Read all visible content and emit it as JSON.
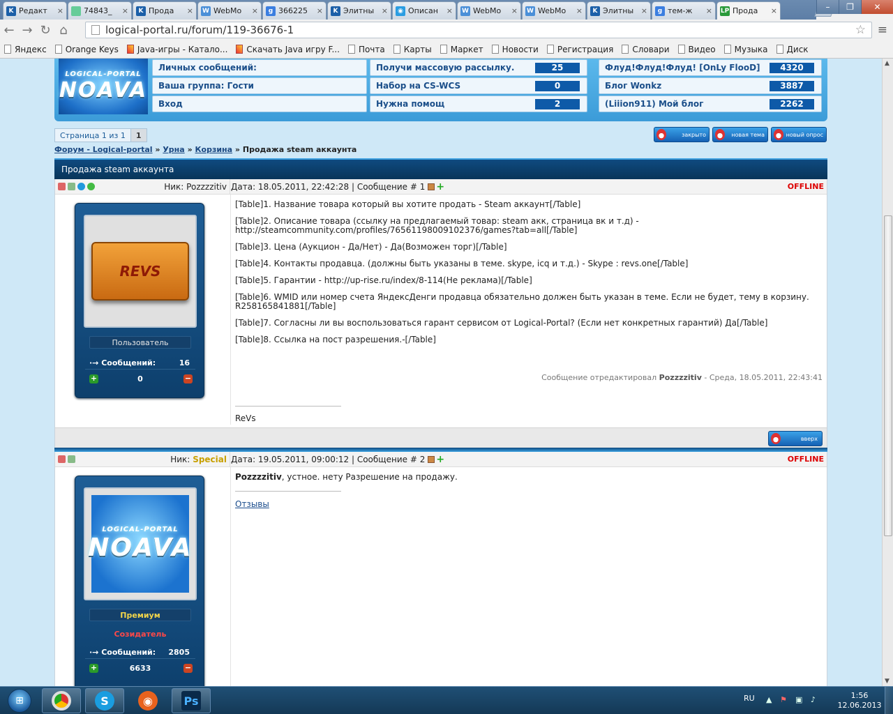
{
  "browser": {
    "tabs": [
      {
        "title": "Редакт",
        "icon_color": "#1b5fa8",
        "glyph": "K"
      },
      {
        "title": "74843_",
        "icon_color": "#6c9",
        "glyph": ""
      },
      {
        "title": "Прода",
        "icon_color": "#1b5fa8",
        "glyph": "K"
      },
      {
        "title": "WebMo",
        "icon_color": "#4a8fd8",
        "glyph": "W"
      },
      {
        "title": "366225",
        "icon_color": "#3b7ee0",
        "glyph": "g"
      },
      {
        "title": "Элитны",
        "icon_color": "#1b5fa8",
        "glyph": "K"
      },
      {
        "title": "Описан",
        "icon_color": "#2a9de2",
        "glyph": "◉"
      },
      {
        "title": "WebMo",
        "icon_color": "#4a8fd8",
        "glyph": "W"
      },
      {
        "title": "WebMo",
        "icon_color": "#4a8fd8",
        "glyph": "W"
      },
      {
        "title": "Элитны",
        "icon_color": "#1b5fa8",
        "glyph": "K"
      },
      {
        "title": "тем-ж",
        "icon_color": "#3b7ee0",
        "glyph": "g"
      },
      {
        "title": "Прода",
        "icon_color": "#2a9a3a",
        "glyph": "LP"
      }
    ],
    "url": "logical-portal.ru/forum/119-36676-1",
    "bookmarks": [
      "Яндекс",
      "Orange Keys",
      "Java-игры - Катало...",
      "Скачать Java игру F...",
      "Почта",
      "Карты",
      "Маркет",
      "Новости",
      "Регистрация",
      "Словари",
      "Видео",
      "Музыка",
      "Диск"
    ]
  },
  "header": {
    "logo_sub": "LOGICAL-PORTAL",
    "logo_main": "NOAVA",
    "stats_left": [
      {
        "label": "Личных сообщений:"
      },
      {
        "label": "Ваша группа: Гости"
      },
      {
        "label": "Вход"
      }
    ],
    "stats_mid": [
      {
        "label": "Получи массовую рассылку.",
        "count": "25"
      },
      {
        "label": "Набор на CS-WCS",
        "count": "0"
      },
      {
        "label": "Нужна помощ",
        "count": "2"
      }
    ],
    "stats_right": [
      {
        "label": "Флуд!Флуд!Флуд! [OnLy FlooD]",
        "count": "4320"
      },
      {
        "label": "Блог Wonkz",
        "count": "3887"
      },
      {
        "label": "(Liiion911) Мой блог",
        "count": "2262"
      }
    ]
  },
  "pager": {
    "label": "Страница 1 из 1",
    "current": "1"
  },
  "topic_buttons": [
    "закрыто",
    "новая тема",
    "новый опрос"
  ],
  "breadcrumb": {
    "forum": "Форум - Logical-portal",
    "sep": "»",
    "section1": "Урна",
    "section2": "Корзина",
    "current": "Продажа steam аккаунта"
  },
  "thread_title": "Продажа steam аккаунта",
  "posts": [
    {
      "nick_label": "Ник:",
      "nick": "Pozzzzitiv",
      "meta": "Дата: 18.05.2011, 22:42:28 | Сообщение # 1",
      "status": "OFFLINE",
      "rank": "Пользователь",
      "group": "",
      "msgs_label": "Сообщений:",
      "msgs": "16",
      "reputation": "0",
      "lines": [
        "[Table]1. Название товара который вы хотите продать - Steam аккаунт[/Table]",
        "[Table]2. Описание товара (ссылку на предлагаемый товар: steam акк, страница вк и т.д) - http://steamcommunity.com/profiles/76561198009102376/games?tab=all[/Table]",
        "[Table]3. Цена (Аукцион - Да/Нет) - Да(Возможен торг)[/Table]",
        "[Table]4. Контакты продавца. (должны быть указаны в теме. skype, icq и т.д.) - Skype : revs.one[/Table]",
        "[Table]5. Гарантии - http://up-rise.ru/index/8-114(Не реклама)[/Table]",
        "[Table]6. WMID или номер счета ЯндексДенги продавца обязательно должен быть указан в теме. Если не будет, тему в корзину. R258165841881[/Table]",
        "[Table]7. Согласны ли вы воспользоваться гарант сервисом от Logical-Portal? (Если нет конкретных гарантий) Да[/Table]",
        "[Table]8. Ссылка на пост разрешения.-[/Table]"
      ],
      "edited_prefix": "Сообщение отредактировал",
      "edited_by": "Pozzzzitiv",
      "edited_suffix": "- Среда, 18.05.2011, 22:43:41",
      "signature": "ReVs",
      "avatar_text": "REVS"
    },
    {
      "nick_label": "Ник:",
      "nick": "Special",
      "meta": "Дата: 19.05.2011, 09:00:12 | Сообщение # 2",
      "status": "OFFLINE",
      "rank": "Премиум",
      "group": "Созидатель",
      "msgs_label": "Сообщений:",
      "msgs": "2805",
      "reputation": "6633",
      "reply_bold": "Pozzzzitiv",
      "reply_text": ", устное. нету Разрешение на продажу.",
      "signature": "Отзывы"
    }
  ],
  "up_button": "вверх",
  "taskbar": {
    "lang": "RU",
    "time": "1:56",
    "date": "12.06.2013"
  },
  "colors": {
    "accent": "#0e5aa8",
    "header": "#3b9bd8",
    "offline": "#dd0000",
    "special_nick": "#c8a000"
  }
}
